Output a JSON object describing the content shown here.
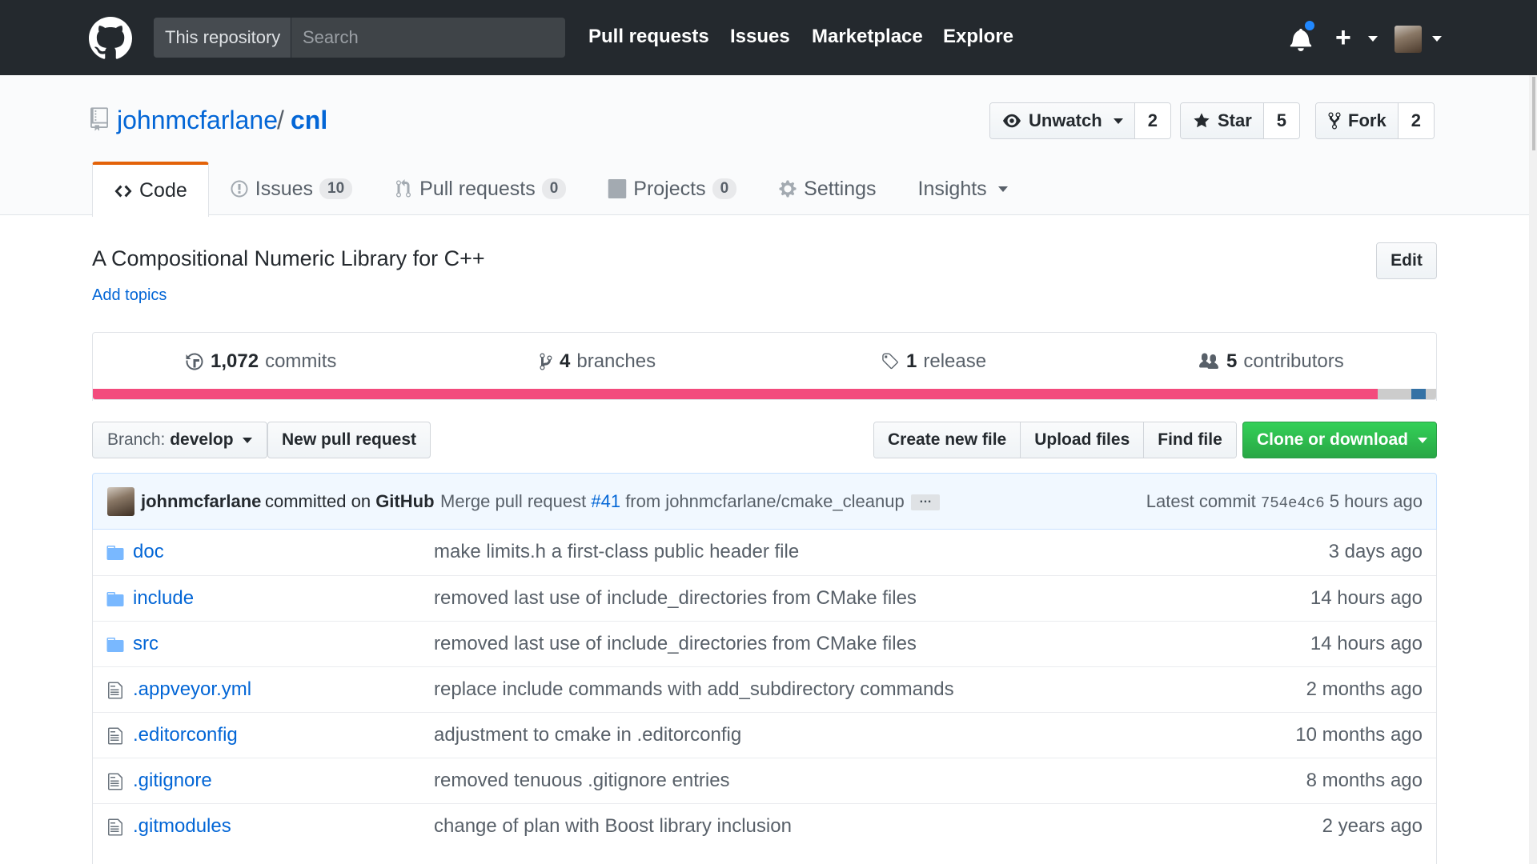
{
  "header": {
    "search_scope": "This repository",
    "search_placeholder": "Search",
    "nav": [
      "Pull requests",
      "Issues",
      "Marketplace",
      "Explore"
    ],
    "notification_dot_color": "#2188ff",
    "plus_label": "+"
  },
  "repo": {
    "owner": "johnmcfarlane",
    "separator": "/",
    "name": "cnl",
    "watch_label": "Unwatch",
    "watch_count": "2",
    "star_label": "Star",
    "star_count": "5",
    "fork_label": "Fork",
    "fork_count": "2"
  },
  "tabs": [
    {
      "label": "Code",
      "icon": "code-icon"
    },
    {
      "label": "Issues",
      "icon": "issue-icon",
      "count": "10"
    },
    {
      "label": "Pull requests",
      "icon": "pull-request-icon",
      "count": "0"
    },
    {
      "label": "Projects",
      "icon": "project-icon",
      "count": "0"
    },
    {
      "label": "Settings",
      "icon": "gear-icon"
    },
    {
      "label": "Insights",
      "icon": "caret-icon"
    }
  ],
  "description": "A Compositional Numeric Library for C++",
  "add_topics": "Add topics",
  "edit_label": "Edit",
  "summary": {
    "commits_count": "1,072",
    "commits_label": "commits",
    "branches_count": "4",
    "branches_label": "branches",
    "releases_count": "1",
    "releases_label": "release",
    "contributors_count": "5",
    "contributors_label": "contributors"
  },
  "language_colors": [
    "#f34b7d",
    "#cccccc",
    "#3572A5"
  ],
  "file_nav": {
    "branch_prefix": "Branch:",
    "branch_name": "develop",
    "new_pr": "New pull request",
    "create_file": "Create new file",
    "upload_files": "Upload files",
    "find_file": "Find file",
    "clone": "Clone or download"
  },
  "commit": {
    "author": "johnmcfarlane",
    "committed_on": "committed on",
    "platform": "GitHub",
    "message_prefix": "Merge pull request",
    "pr_link": "#41",
    "message_suffix": "from johnmcfarlane/cmake_cleanup",
    "ellipsis": "…",
    "latest_label": "Latest commit",
    "sha": "754e4c6",
    "age": "5 hours ago"
  },
  "files": [
    {
      "type": "dir",
      "name": "doc",
      "message": "make limits.h a first-class public header file",
      "age": "3 days ago"
    },
    {
      "type": "dir",
      "name": "include",
      "message": "removed last use of include_directories from CMake files",
      "age": "14 hours ago"
    },
    {
      "type": "dir",
      "name": "src",
      "message": "removed last use of include_directories from CMake files",
      "age": "14 hours ago"
    },
    {
      "type": "file",
      "name": ".appveyor.yml",
      "message": "replace include commands with add_subdirectory commands",
      "age": "2 months ago"
    },
    {
      "type": "file",
      "name": ".editorconfig",
      "message": "adjustment to cmake in .editorconfig",
      "age": "10 months ago"
    },
    {
      "type": "file",
      "name": ".gitignore",
      "message": "removed tenuous .gitignore entries",
      "age": "8 months ago"
    },
    {
      "type": "file",
      "name": ".gitmodules",
      "message": "change of plan with Boost library inclusion",
      "age": "2 years ago"
    }
  ]
}
